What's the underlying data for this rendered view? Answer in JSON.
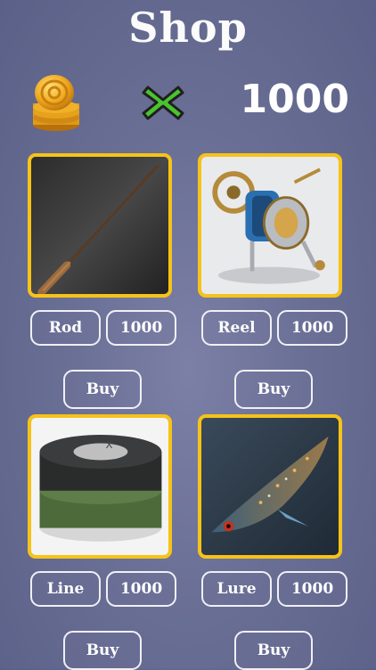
{
  "header": {
    "title": "Shop",
    "coin_icon": "gold-coins-icon",
    "multiplier_icon": "green-x-icon",
    "balance": "1000"
  },
  "items": [
    {
      "name": "Rod",
      "price": "1000",
      "buy_label": "Buy",
      "image": "fishing-rod"
    },
    {
      "name": "Reel",
      "price": "1000",
      "buy_label": "Buy",
      "image": "fishing-reel"
    },
    {
      "name": "Line",
      "price": "1000",
      "buy_label": "Buy",
      "image": "fishing-line-spool"
    },
    {
      "name": "Lure",
      "price": "1000",
      "buy_label": "Buy",
      "image": "fish-lure"
    }
  ],
  "colors": {
    "card_border": "#f6c318",
    "close_icon": "#3fbf2f",
    "background": "#6a6f95"
  }
}
